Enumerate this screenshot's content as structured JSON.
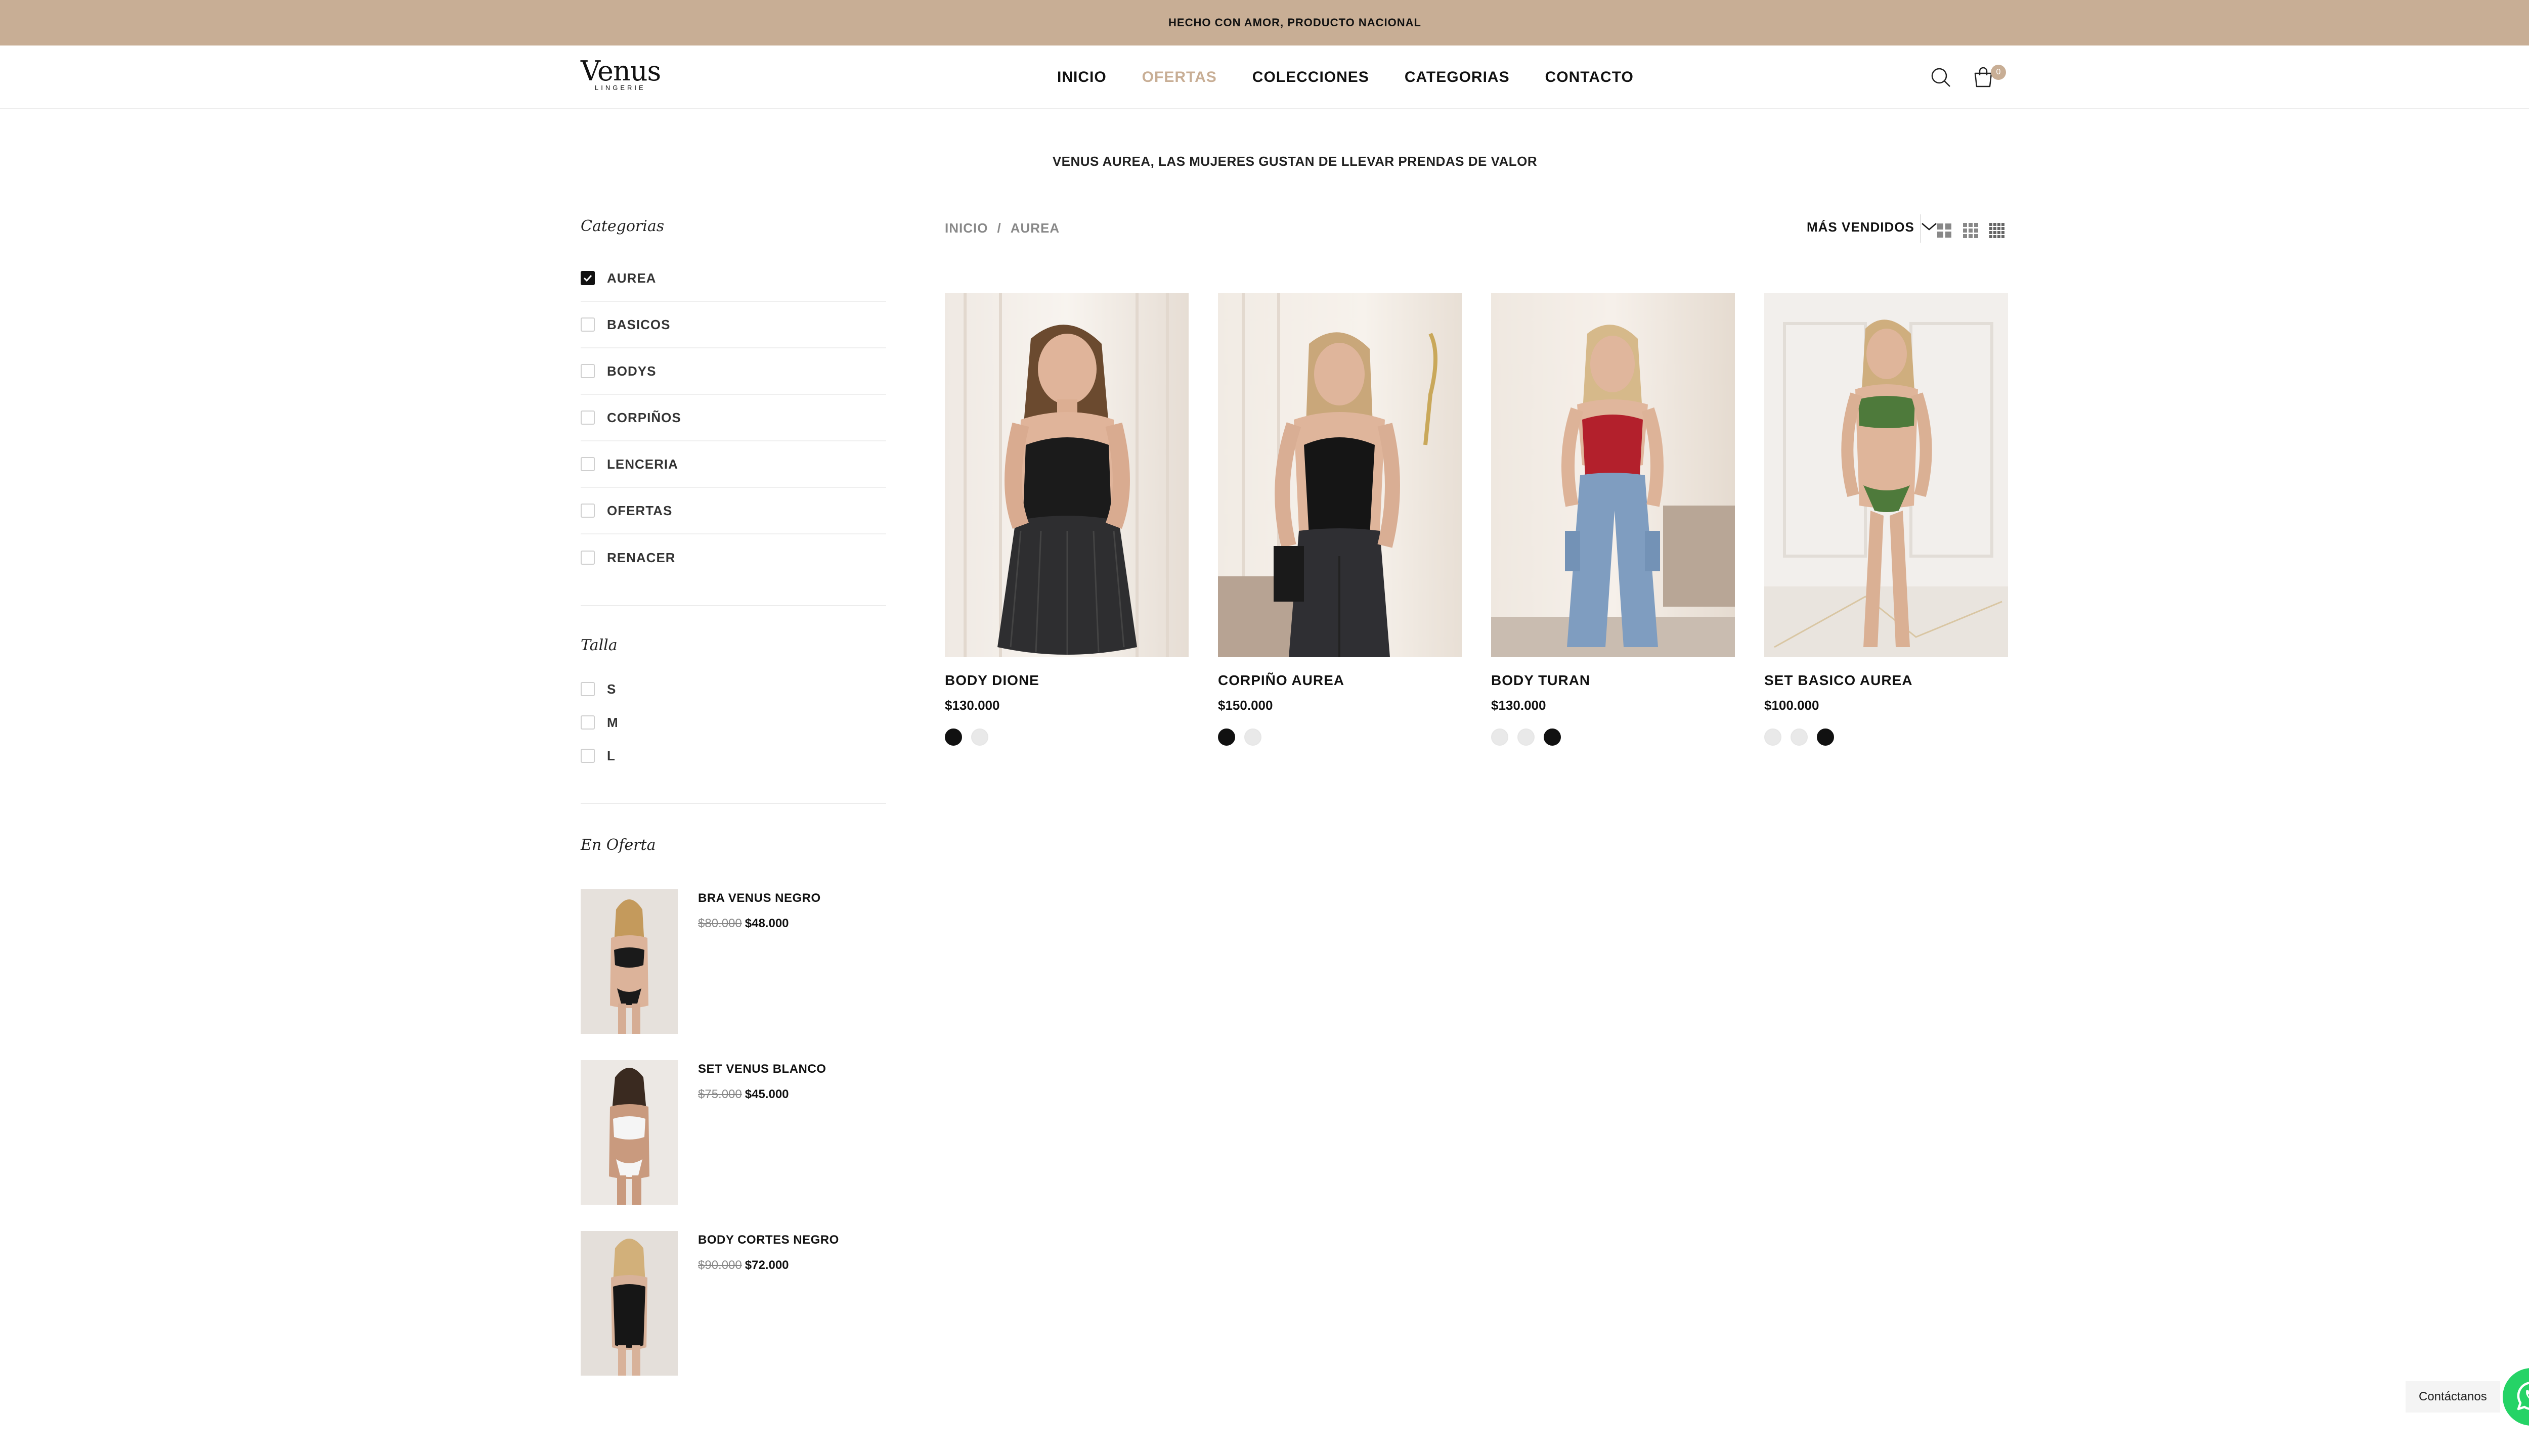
{
  "announcement": "HECHO CON AMOR, PRODUCTO NACIONAL",
  "brand": {
    "name": "Venus",
    "sub": "LINGERIE"
  },
  "nav": [
    {
      "label": "INICIO",
      "active": false
    },
    {
      "label": "OFERTAS",
      "active": true
    },
    {
      "label": "COLECCIONES",
      "active": false
    },
    {
      "label": "CATEGORIAS",
      "active": false
    },
    {
      "label": "CONTACTO",
      "active": false
    }
  ],
  "header": {
    "cart_count": "0"
  },
  "tagline": "VENUS AUREA, LAS MUJERES GUSTAN DE LLEVAR PRENDAS DE VALOR",
  "sidebar": {
    "categories_title": "Categorias",
    "categories": [
      {
        "label": "AUREA",
        "checked": true
      },
      {
        "label": "BASICOS",
        "checked": false
      },
      {
        "label": "BODYS",
        "checked": false
      },
      {
        "label": "CORPIÑOS",
        "checked": false
      },
      {
        "label": "LENCERIA",
        "checked": false
      },
      {
        "label": "OFERTAS",
        "checked": false
      },
      {
        "label": "RENACER",
        "checked": false
      }
    ],
    "size_title": "Talla",
    "sizes": [
      "S",
      "M",
      "L"
    ],
    "offers_title": "En Oferta",
    "offers": [
      {
        "name": "BRA VENUS NEGRO",
        "old_price": "$80.000",
        "new_price": "$48.000"
      },
      {
        "name": "SET VENUS BLANCO",
        "old_price": "$75.000",
        "new_price": "$45.000"
      },
      {
        "name": "BODY CORTES NEGRO",
        "old_price": "$90.000",
        "new_price": "$72.000"
      }
    ]
  },
  "breadcrumb": {
    "home": "INICIO",
    "separator": "/",
    "current": "AUREA"
  },
  "sort": {
    "label": "MÁS VENDIDOS"
  },
  "products": [
    {
      "name": "BODY DIONE",
      "price": "$130.000",
      "swatches": [
        "#111111",
        "#e9e9e9"
      ]
    },
    {
      "name": "CORPIÑO AUREA",
      "price": "$150.000",
      "swatches": [
        "#111111",
        "#e9e9e9"
      ]
    },
    {
      "name": "BODY TURAN",
      "price": "$130.000",
      "swatches": [
        "#e9e9e9",
        "#e9e9e9",
        "#111111"
      ]
    },
    {
      "name": "SET BASICO AUREA",
      "price": "$100.000",
      "swatches": [
        "#e9e9e9",
        "#e9e9e9",
        "#111111"
      ]
    }
  ],
  "whatsapp": {
    "label": "Contáctanos"
  },
  "colors": {
    "accent": "#c8ae95",
    "whatsapp": "#25d366"
  }
}
